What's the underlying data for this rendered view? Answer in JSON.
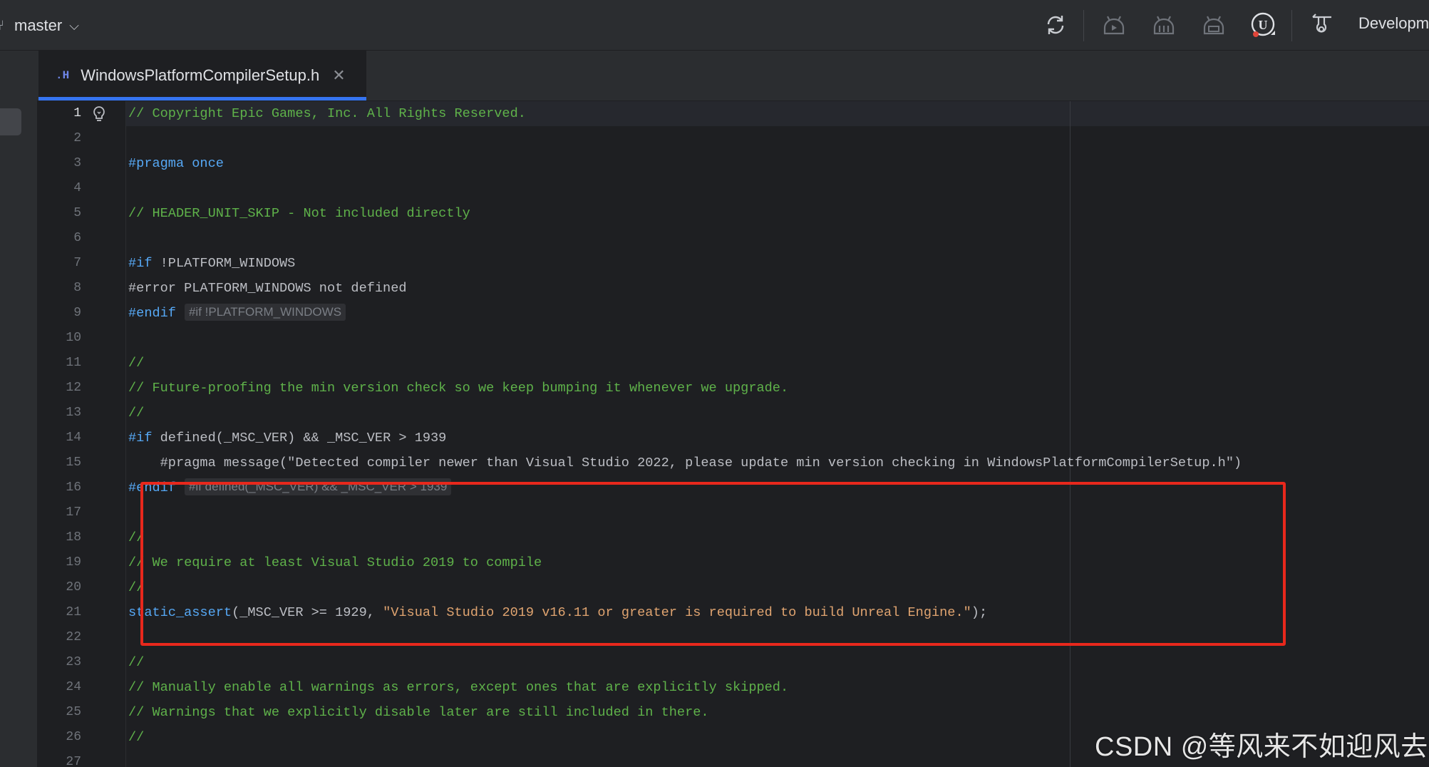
{
  "toolbar": {
    "branch_label": "master",
    "config_label": "Developm",
    "icons": [
      "vcs-branch-icon",
      "refresh-icon",
      "build-icon",
      "rebuild-icon",
      "clean-icon",
      "unreal-engine-icon",
      "run-config-icon"
    ]
  },
  "tab": {
    "file_type": ".H",
    "file_name": "WindowsPlatformCompilerSetup.h",
    "close_glyph": "✕"
  },
  "editor": {
    "lines": [
      {
        "n": "1",
        "parts": [
          {
            "t": "// Copyright Epic Games, Inc. All Rights Reserved.",
            "c": "c-comment"
          }
        ]
      },
      {
        "n": "2",
        "parts": []
      },
      {
        "n": "3",
        "parts": [
          {
            "t": "#pragma once",
            "c": "c-kw"
          }
        ]
      },
      {
        "n": "4",
        "parts": []
      },
      {
        "n": "5",
        "parts": [
          {
            "t": "// HEADER_UNIT_SKIP - Not included directly",
            "c": "c-comment"
          }
        ]
      },
      {
        "n": "6",
        "parts": []
      },
      {
        "n": "7",
        "parts": [
          {
            "t": "#if",
            "c": "c-kw"
          },
          {
            "t": " !PLATFORM_WINDOWS",
            "c": "c-plain"
          }
        ]
      },
      {
        "n": "8",
        "parts": [
          {
            "t": "#error PLATFORM_WINDOWS not defined",
            "c": "c-plain"
          }
        ]
      },
      {
        "n": "9",
        "parts": [
          {
            "t": "#endif",
            "c": "c-kw"
          },
          {
            "t": "#if !PLATFORM_WINDOWS",
            "c": "hint"
          }
        ]
      },
      {
        "n": "10",
        "parts": []
      },
      {
        "n": "11",
        "parts": [
          {
            "t": "//",
            "c": "c-comment"
          }
        ]
      },
      {
        "n": "12",
        "parts": [
          {
            "t": "// Future-proofing the min version check so we keep bumping it whenever we upgrade.",
            "c": "c-comment"
          }
        ]
      },
      {
        "n": "13",
        "parts": [
          {
            "t": "//",
            "c": "c-comment"
          }
        ]
      },
      {
        "n": "14",
        "parts": [
          {
            "t": "#if",
            "c": "c-kw"
          },
          {
            "t": " defined(_MSC_VER) && _MSC_VER > ",
            "c": "c-plain"
          },
          {
            "t": "1939",
            "c": "c-plain"
          }
        ]
      },
      {
        "n": "15",
        "parts": [
          {
            "t": "    #pragma message(\"Detected compiler newer than Visual Studio 2022, please update min version checking in WindowsPlatformCompilerSetup.h\")",
            "c": "c-plain"
          }
        ]
      },
      {
        "n": "16",
        "parts": [
          {
            "t": "#endif",
            "c": "c-kw"
          },
          {
            "t": "#if defined(_MSC_VER) && _MSC_VER > 1939",
            "c": "hint"
          }
        ]
      },
      {
        "n": "17",
        "parts": []
      },
      {
        "n": "18",
        "parts": [
          {
            "t": "//",
            "c": "c-comment"
          }
        ]
      },
      {
        "n": "19",
        "parts": [
          {
            "t": "// We require at least Visual Studio 2019 to compile",
            "c": "c-comment"
          }
        ]
      },
      {
        "n": "20",
        "parts": [
          {
            "t": "//",
            "c": "c-comment"
          }
        ]
      },
      {
        "n": "21",
        "parts": [
          {
            "t": "static_assert",
            "c": "c-fn"
          },
          {
            "t": "(_MSC_VER >= 1929, ",
            "c": "c-plain"
          },
          {
            "t": "\"Visual Studio 2019 v16.11 or greater is required to build Unreal Engine.\"",
            "c": "c-str"
          },
          {
            "t": ");",
            "c": "c-plain"
          }
        ]
      },
      {
        "n": "22",
        "parts": []
      },
      {
        "n": "23",
        "parts": [
          {
            "t": "//",
            "c": "c-comment"
          }
        ]
      },
      {
        "n": "24",
        "parts": [
          {
            "t": "// Manually enable all warnings as errors, except ones that are explicitly skipped.",
            "c": "c-comment"
          }
        ]
      },
      {
        "n": "25",
        "parts": [
          {
            "t": "// Warnings that we explicitly disable later are still included in there.",
            "c": "c-comment"
          }
        ]
      },
      {
        "n": "26",
        "parts": [
          {
            "t": "//",
            "c": "c-comment"
          }
        ]
      },
      {
        "n": "27",
        "parts": []
      }
    ]
  },
  "watermark": "CSDN @等风来不如迎风去",
  "colors": {
    "highlight_box": "#e8281c",
    "tab_underline": "#3574f0",
    "comment": "#5fb24a",
    "keyword": "#56a8f5",
    "string": "#e0a470"
  }
}
